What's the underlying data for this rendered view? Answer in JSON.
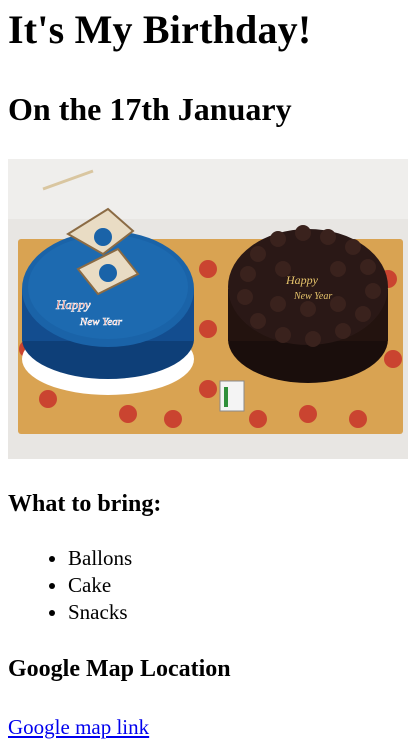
{
  "page": {
    "title": "It's My Birthday!",
    "date_heading": "On the 17th January",
    "photo": {
      "alt": "Two cakes: a blue cake and a chocolate cake",
      "cake_topper_text": [
        "Happy",
        "New Year"
      ]
    },
    "bring": {
      "heading": "What to bring:",
      "items": [
        "Ballons",
        "Cake",
        "Snacks"
      ]
    },
    "map": {
      "heading": "Google Map Location",
      "link_label": "Google map link"
    }
  },
  "colors": {
    "link": "#0000ee",
    "blue_cake": "#1a63a8",
    "chocolate_cake": "#2a1816",
    "board": "#d4a04c"
  }
}
